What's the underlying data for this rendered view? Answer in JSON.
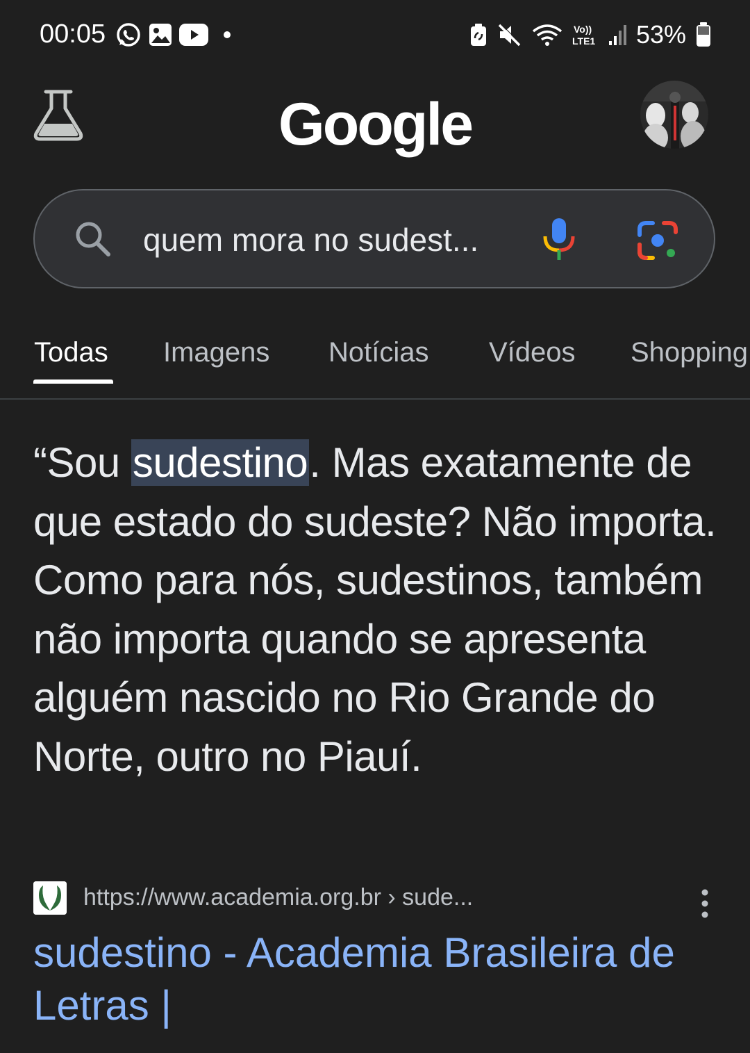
{
  "status_bar": {
    "time": "00:05",
    "battery": "53%",
    "network_label_top": "Vo))",
    "network_label_bottom": "LTE1",
    "left_icons": [
      "whatsapp-icon",
      "gallery-icon",
      "youtube-icon",
      "dot-icon"
    ],
    "right_icons": [
      "battery-saver-icon",
      "mute-icon",
      "wifi-icon",
      "volte-icon",
      "signal-icon",
      "battery-icon"
    ]
  },
  "header": {
    "logo": "Google",
    "labs_icon": "flask-icon",
    "avatar": "profile-avatar"
  },
  "search": {
    "query": "quem mora no sudest..."
  },
  "tabs": [
    {
      "label": "Todas",
      "active": true
    },
    {
      "label": "Imagens",
      "active": false
    },
    {
      "label": "Notícias",
      "active": false
    },
    {
      "label": "Vídeos",
      "active": false
    },
    {
      "label": "Shopping",
      "active": false
    }
  ],
  "snippet": {
    "before": "“Sou ",
    "highlight": "sudestino",
    "after": ". Mas exatamente de que estado do sudeste? Não importa. Como para nós, sudestinos, também não importa quando se apresenta alguém nascido no Rio Grande do Norte, outro no Piauí."
  },
  "result": {
    "url": "https://www.academia.org.br › sude...",
    "title": "sudestino - Academia Brasileira de Letras |"
  },
  "colors": {
    "background": "#1f1f1f",
    "search_bg": "#303134",
    "link": "#8ab4f8",
    "highlight_bg": "#394457"
  }
}
